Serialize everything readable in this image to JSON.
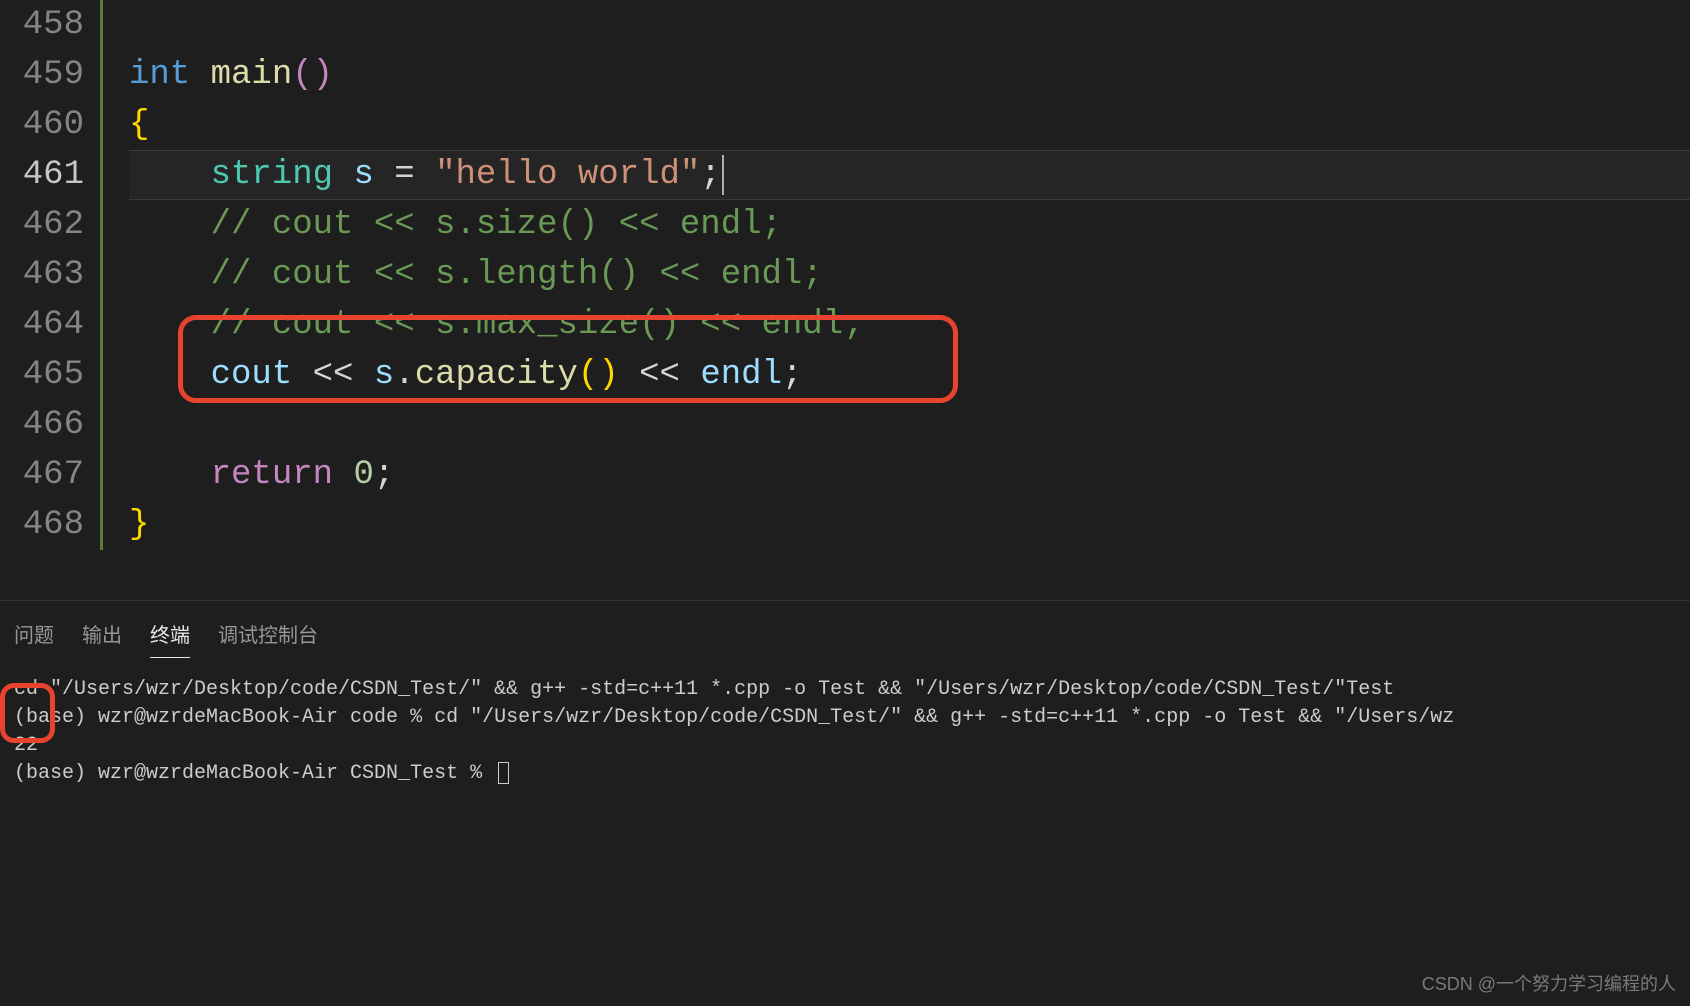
{
  "editor": {
    "lines": [
      {
        "num": "458",
        "tokens": []
      },
      {
        "num": "459",
        "tokens": [
          {
            "t": "tok-kw",
            "v": "int"
          },
          {
            "t": "tok-op",
            "v": " "
          },
          {
            "t": "tok-fn",
            "v": "main"
          },
          {
            "t": "tok-paren",
            "v": "()"
          }
        ]
      },
      {
        "num": "460",
        "tokens": [
          {
            "t": "tok-brace",
            "v": "{"
          }
        ]
      },
      {
        "num": "461",
        "active": true,
        "indent": "    ",
        "tokens": [
          {
            "t": "tok-type",
            "v": "string"
          },
          {
            "t": "tok-op",
            "v": " "
          },
          {
            "t": "tok-var",
            "v": "s"
          },
          {
            "t": "tok-op",
            "v": " = "
          },
          {
            "t": "tok-str",
            "v": "\"hello world\""
          },
          {
            "t": "tok-punc",
            "v": ";"
          }
        ],
        "cursor": true
      },
      {
        "num": "462",
        "indent": "    ",
        "tokens": [
          {
            "t": "tok-comment",
            "v": "// cout << s.size() << endl;"
          }
        ]
      },
      {
        "num": "463",
        "indent": "    ",
        "tokens": [
          {
            "t": "tok-comment",
            "v": "// cout << s.length() << endl;"
          }
        ]
      },
      {
        "num": "464",
        "indent": "    ",
        "tokens": [
          {
            "t": "tok-comment",
            "v": "// cout << s.max_size() << endl;"
          }
        ]
      },
      {
        "num": "465",
        "indent": "    ",
        "tokens": [
          {
            "t": "tok-var",
            "v": "cout"
          },
          {
            "t": "tok-op",
            "v": " << "
          },
          {
            "t": "tok-var",
            "v": "s"
          },
          {
            "t": "tok-punc",
            "v": "."
          },
          {
            "t": "tok-fn",
            "v": "capacity"
          },
          {
            "t": "tok-paren-inner",
            "v": "()"
          },
          {
            "t": "tok-op",
            "v": " << "
          },
          {
            "t": "tok-var",
            "v": "endl"
          },
          {
            "t": "tok-punc",
            "v": ";"
          }
        ]
      },
      {
        "num": "466",
        "tokens": []
      },
      {
        "num": "467",
        "indent": "    ",
        "tokens": [
          {
            "t": "tok-paren",
            "v": "return"
          },
          {
            "t": "tok-op",
            "v": " "
          },
          {
            "t": "tok-num",
            "v": "0"
          },
          {
            "t": "tok-punc",
            "v": ";"
          }
        ]
      },
      {
        "num": "468",
        "tokens": [
          {
            "t": "tok-brace",
            "v": "}"
          }
        ]
      }
    ]
  },
  "panel": {
    "tabs": {
      "problems": "问题",
      "output": "输出",
      "terminal": "终端",
      "debug_console": "调试控制台"
    },
    "terminal_lines": [
      "cd \"/Users/wzr/Desktop/code/CSDN_Test/\" && g++ -std=c++11 *.cpp -o Test && \"/Users/wzr/Desktop/code/CSDN_Test/\"Test",
      "(base) wzr@wzrdeMacBook-Air code % cd \"/Users/wzr/Desktop/code/CSDN_Test/\" && g++ -std=c++11 *.cpp -o Test && \"/Users/wz",
      "22",
      "(base) wzr@wzrdeMacBook-Air CSDN_Test % "
    ]
  },
  "watermark": "CSDN @一个努力学习编程的人"
}
